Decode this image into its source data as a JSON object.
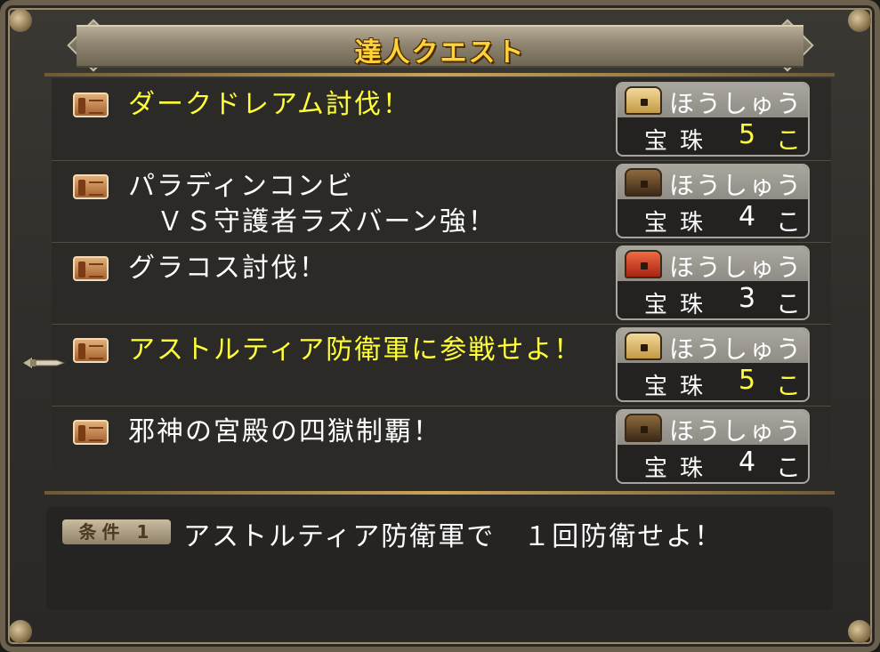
{
  "header": {
    "title": "達人クエスト"
  },
  "quests": [
    {
      "name": "ダークドレアム討伐！",
      "highlight": true,
      "reward": {
        "label": "ほうしゅう",
        "item": "宝珠",
        "count": "5",
        "unit": "こ",
        "chest": "gold-chest-icon"
      }
    },
    {
      "name": "パラディンコンビ\n　ＶＳ守護者ラズバーン強！",
      "highlight": false,
      "reward": {
        "label": "ほうしゅう",
        "item": "宝珠",
        "count": "4",
        "unit": "こ",
        "chest": "dark-chest-icon"
      }
    },
    {
      "name": "グラコス討伐！",
      "highlight": false,
      "reward": {
        "label": "ほうしゅう",
        "item": "宝珠",
        "count": "3",
        "unit": "こ",
        "chest": "red-chest-icon"
      }
    },
    {
      "name": "アストルティア防衛軍に参戦せよ！",
      "highlight": true,
      "reward": {
        "label": "ほうしゅう",
        "item": "宝珠",
        "count": "5",
        "unit": "こ",
        "chest": "gold-chest-icon"
      }
    },
    {
      "name": "邪神の宮殿の四獄制覇！",
      "highlight": false,
      "reward": {
        "label": "ほうしゅう",
        "item": "宝珠",
        "count": "4",
        "unit": "こ",
        "chest": "dark-chest-icon"
      }
    }
  ],
  "condition": {
    "badge": "条件 1",
    "text": "アストルティア防衛軍で　１回防衛せよ！"
  },
  "colors": {
    "highlight": "#ffff3a",
    "title": "#ffd23a",
    "text": "#ffffff"
  }
}
